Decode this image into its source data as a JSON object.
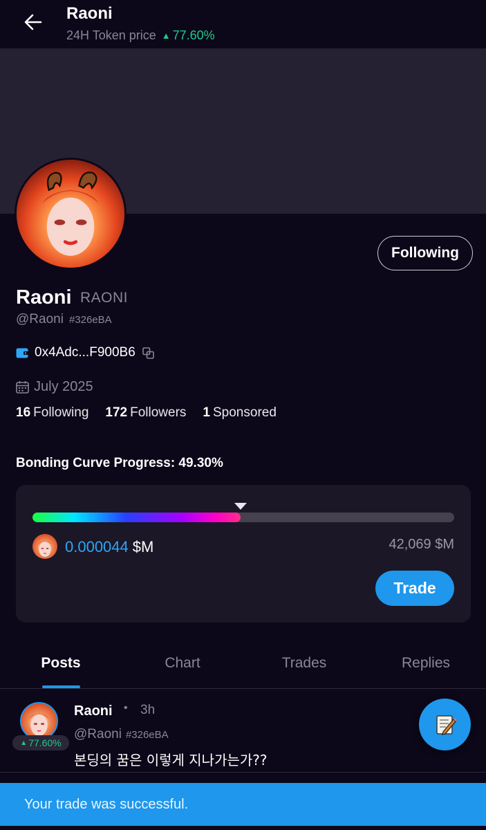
{
  "header": {
    "title": "Raoni",
    "subtitle_label": "24H Token price",
    "price_change": "77.60%"
  },
  "profile": {
    "follow_button": "Following",
    "name": "Raoni",
    "ticker": "RAONI",
    "handle": "@Raoni",
    "tag": "#326eBA",
    "wallet": "0x4Adc...F900B6",
    "joined": "July 2025",
    "stats": {
      "following_count": "16",
      "following_label": "Following",
      "followers_count": "172",
      "followers_label": "Followers",
      "sponsored_count": "1",
      "sponsored_label": "Sponsored"
    }
  },
  "bonding_curve": {
    "title": "Bonding Curve Progress: 49.30%",
    "progress": 0.493,
    "price_value": "0.000044",
    "price_unit": "$M",
    "market_cap": "42,069 $M",
    "trade_button": "Trade"
  },
  "tabs": [
    {
      "label": "Posts",
      "active": true
    },
    {
      "label": "Chart",
      "active": false
    },
    {
      "label": "Trades",
      "active": false
    },
    {
      "label": "Replies",
      "active": false
    }
  ],
  "post": {
    "badge": "77.60%",
    "name": "Raoni",
    "dot": "•",
    "time": "3h",
    "handle": "@Raoni",
    "tag": "#326eBA",
    "text": "본딩의 꿈은 이렇게 지나가는가??"
  },
  "toast": {
    "message": "Your trade was successful."
  },
  "colors": {
    "background": "#0c0819",
    "banner": "#262132",
    "accent": "#1e97ec",
    "positive": "#1fc98a",
    "muted": "#8a8697"
  },
  "icons": {
    "back": "arrow-left-icon",
    "wallet": "wallet-icon",
    "copy": "copy-icon",
    "calendar": "calendar-icon",
    "compose": "compose-icon"
  }
}
